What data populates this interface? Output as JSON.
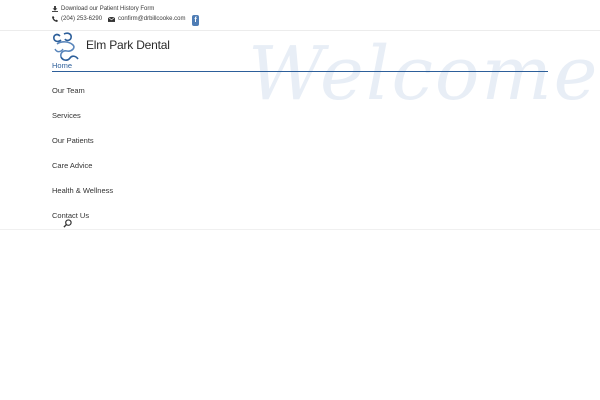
{
  "topbar": {
    "download_label": "Download our Patient History Form",
    "phone": "(204) 253-6290",
    "email": "confirm@drbillcooke.com",
    "facebook_glyph": "f"
  },
  "header": {
    "brand": "Elm Park Dental",
    "watermark": "Welcome..."
  },
  "nav": {
    "items": [
      {
        "label": "Home",
        "active": true
      },
      {
        "label": "Our Team"
      },
      {
        "label": "Services"
      },
      {
        "label": "Our Patients"
      },
      {
        "label": "Care Advice"
      },
      {
        "label": "Health & Wellness"
      },
      {
        "label": "Contact Us"
      }
    ]
  },
  "icons": {
    "download": "download-icon",
    "phone": "phone-icon",
    "email": "envelope-icon",
    "facebook": "facebook-icon",
    "search": "search-icon",
    "logo": "tooth-logo-icon"
  },
  "colors": {
    "accent": "#2d5f9a",
    "watermark": "#e8eef6",
    "facebook": "#4f7db5"
  }
}
